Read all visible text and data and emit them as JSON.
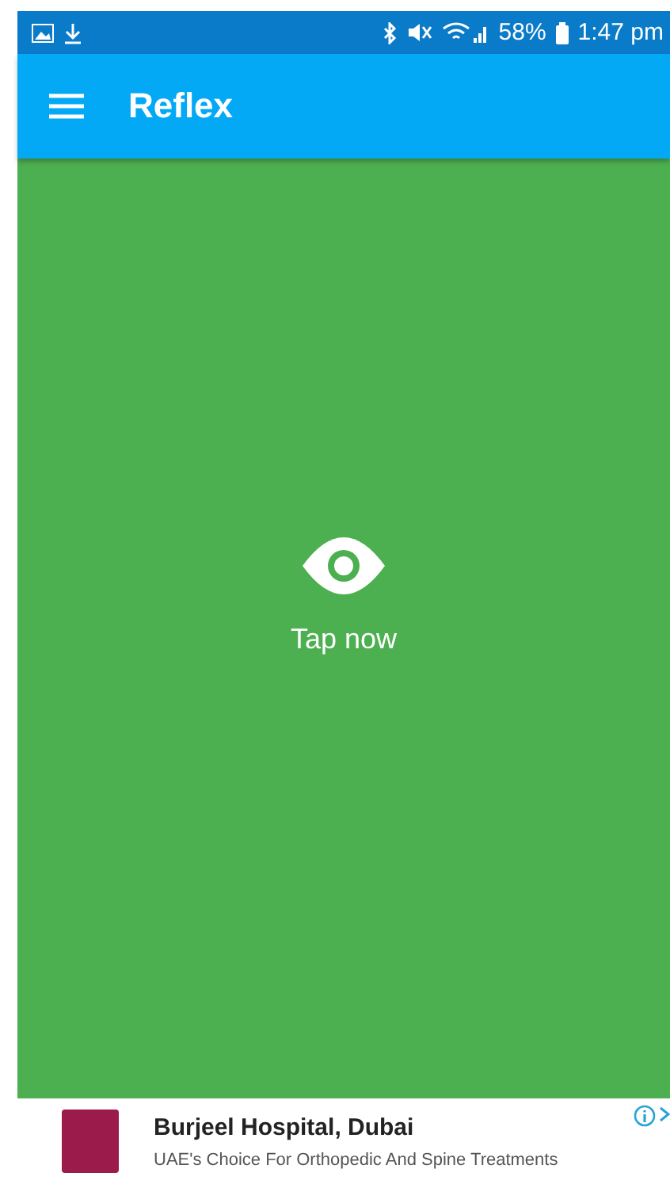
{
  "status_bar": {
    "battery": "58%",
    "time": "1:47 pm"
  },
  "app_bar": {
    "title": "Reflex"
  },
  "main": {
    "prompt": "Tap now"
  },
  "ad": {
    "title": "Burjeel Hospital, Dubai",
    "subtitle": "UAE's Choice For Orthopedic And Spine Treatments"
  }
}
